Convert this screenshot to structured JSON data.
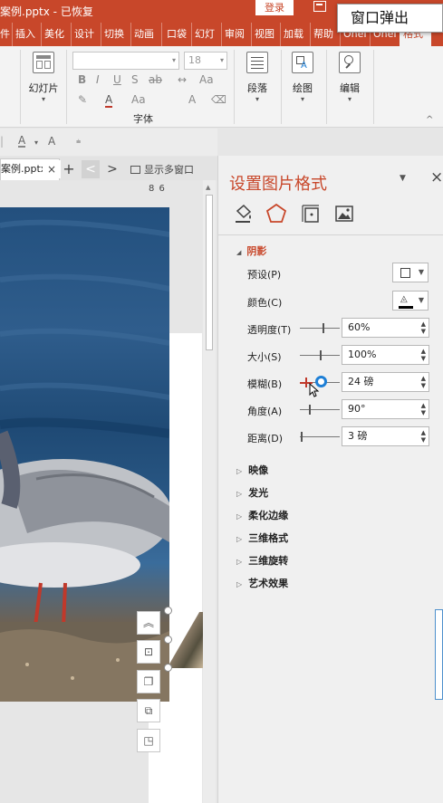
{
  "title_bar": {
    "document": "案例.pptx  -  已恢复",
    "login": "登录"
  },
  "tooltip": {
    "text": "窗口弹出"
  },
  "ribbon_tabs": [
    "插入",
    "美化",
    "设计",
    "切换",
    "动画",
    "口袋",
    "幻灯",
    "审阅",
    "视图",
    "加载",
    "帮助",
    "OneI",
    "OneI",
    "格式"
  ],
  "ribbon": {
    "slides_label": "幻灯片",
    "font_size": "18",
    "font_group": "字体",
    "paragraph": "段落",
    "drawing": "绘图",
    "editing": "编辑",
    "fmt_letters": [
      "B",
      "I",
      "U",
      "S",
      "ab"
    ]
  },
  "quick_access": {
    "items": [
      "A",
      "A"
    ]
  },
  "file_bar": {
    "file_tab": "案例.pptx",
    "close": "×",
    "add": "+",
    "prev": "<",
    "next": ">",
    "multi_window": "显示多窗口"
  },
  "ruler": {
    "text": "8 6"
  },
  "format_pane": {
    "title": "设置图片格式",
    "close": "×",
    "shadow": {
      "header": "阴影",
      "preset_label": "预设(P)",
      "color_label": "颜色(C)",
      "transparency_label": "透明度(T)",
      "transparency_value": "60%",
      "size_label": "大小(S)",
      "size_value": "100%",
      "blur_label": "模糊(B)",
      "blur_value": "24 磅",
      "angle_label": "角度(A)",
      "angle_value": "90°",
      "distance_label": "距离(D)",
      "distance_value": "3 磅"
    },
    "collapsed_sections": [
      "映像",
      "发光",
      "柔化边缘",
      "三维格式",
      "三维旋转",
      "艺术效果"
    ]
  },
  "colors": {
    "accent": "#c8472a",
    "pane_bg": "#f0f0f0",
    "slider_active": "#1e7fd6"
  },
  "icons": [
    "fill-line-icon",
    "effects-pentagon-icon",
    "size-properties-icon",
    "picture-icon",
    "collapse-up-icon",
    "align-icon",
    "bring-forward-icon",
    "send-backward-icon",
    "crop-icon"
  ]
}
